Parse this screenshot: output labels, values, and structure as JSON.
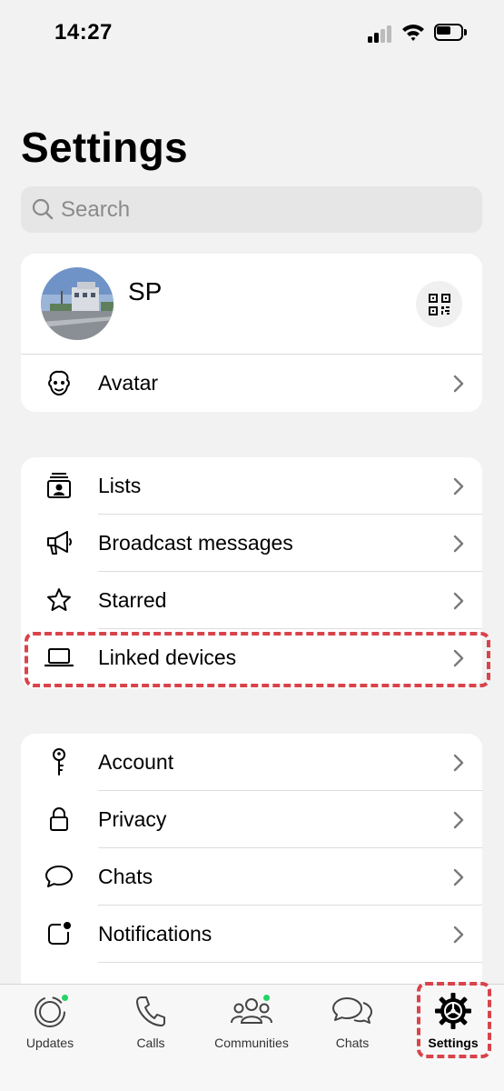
{
  "status_bar": {
    "time": "14:27"
  },
  "page_title": "Settings",
  "search": {
    "placeholder": "Search"
  },
  "profile": {
    "name": "SP"
  },
  "avatar_row": {
    "label": "Avatar"
  },
  "group1": [
    {
      "label": "Lists",
      "icon": "lists-icon"
    },
    {
      "label": "Broadcast messages",
      "icon": "megaphone-icon"
    },
    {
      "label": "Starred",
      "icon": "star-icon"
    },
    {
      "label": "Linked devices",
      "icon": "laptop-icon"
    }
  ],
  "group2": [
    {
      "label": "Account",
      "icon": "key-icon"
    },
    {
      "label": "Privacy",
      "icon": "lock-icon"
    },
    {
      "label": "Chats",
      "icon": "chat-bubble-icon"
    },
    {
      "label": "Notifications",
      "icon": "notification-icon"
    }
  ],
  "tabs": [
    {
      "label": "Updates",
      "icon": "updates-icon",
      "badge": true
    },
    {
      "label": "Calls",
      "icon": "phone-icon",
      "badge": false
    },
    {
      "label": "Communities",
      "icon": "communities-icon",
      "badge": true
    },
    {
      "label": "Chats",
      "icon": "chats-icon",
      "badge": false
    },
    {
      "label": "Settings",
      "icon": "settings-gear-icon",
      "badge": false,
      "active": true
    }
  ],
  "colors": {
    "badge": "#25d366",
    "highlight": "#d9434a"
  }
}
